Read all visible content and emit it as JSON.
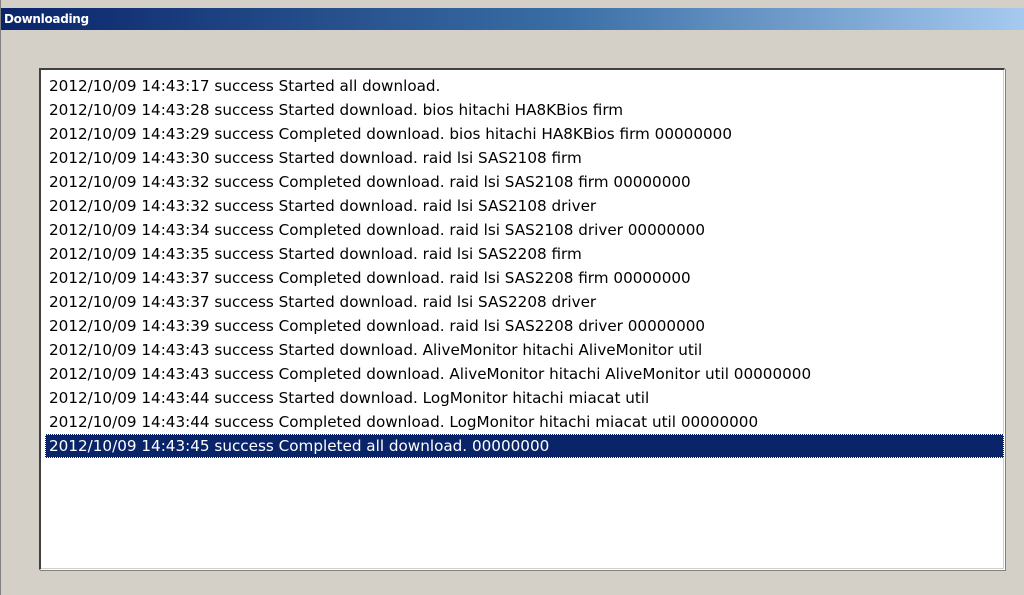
{
  "window": {
    "title": "Downloading"
  },
  "log": {
    "selected_index": 15,
    "entries": [
      "2012/10/09 14:43:17 success Started all download.",
      "2012/10/09 14:43:28 success Started download. bios hitachi HA8KBios firm",
      "2012/10/09 14:43:29 success Completed download. bios hitachi HA8KBios firm 00000000",
      "2012/10/09 14:43:30 success Started download. raid lsi SAS2108 firm",
      "2012/10/09 14:43:32 success Completed download. raid lsi SAS2108 firm 00000000",
      "2012/10/09 14:43:32 success Started download. raid lsi SAS2108 driver",
      "2012/10/09 14:43:34 success Completed download. raid lsi SAS2108 driver 00000000",
      "2012/10/09 14:43:35 success Started download. raid lsi SAS2208 firm",
      "2012/10/09 14:43:37 success Completed download. raid lsi SAS2208 firm 00000000",
      "2012/10/09 14:43:37 success Started download. raid lsi SAS2208 driver",
      "2012/10/09 14:43:39 success Completed download. raid lsi SAS2208 driver 00000000",
      "2012/10/09 14:43:43 success Started download. AliveMonitor hitachi AliveMonitor util",
      "2012/10/09 14:43:43 success Completed download. AliveMonitor hitachi AliveMonitor util 00000000",
      "2012/10/09 14:43:44 success Started download. LogMonitor hitachi miacat util",
      "2012/10/09 14:43:44 success Completed download. LogMonitor hitachi miacat util 00000000",
      "2012/10/09 14:43:45 success Completed all download. 00000000"
    ]
  },
  "colors": {
    "titlebar_start": "#0a246a",
    "titlebar_end": "#a6caf0",
    "selection": "#0a246a",
    "face": "#d4d0c8"
  }
}
